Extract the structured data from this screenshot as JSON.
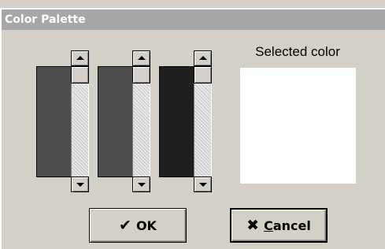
{
  "window": {
    "title": "Color Palette"
  },
  "channels": [
    {
      "name": "channel-1",
      "swatch_color": "#4d4d4d",
      "scroll_position": 0
    },
    {
      "name": "channel-2",
      "swatch_color": "#4d4d4d",
      "scroll_position": 0
    },
    {
      "name": "channel-3",
      "swatch_color": "#1f1f1f",
      "scroll_position": 0
    }
  ],
  "preview": {
    "label": "Selected color",
    "color": "#ffffff"
  },
  "buttons": {
    "ok_label": "OK",
    "ok_icon": "check-icon",
    "cancel_label": "Cancel",
    "cancel_icon": "x-icon"
  },
  "colors": {
    "dialog_bg": "#d4d0c8",
    "titlebar_bg": "#a7a7a7",
    "title_text": "#ffffff"
  }
}
